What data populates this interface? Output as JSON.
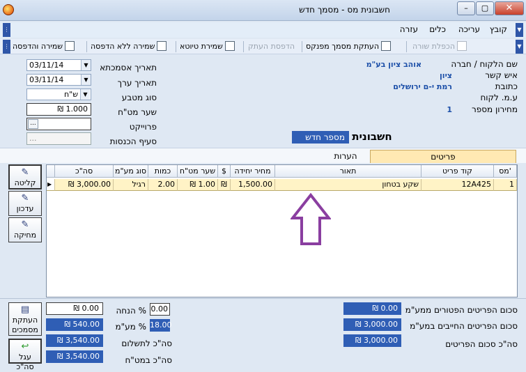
{
  "window": {
    "title": "חשבונית מס - מסמך חדש",
    "min_label": "–",
    "max_label": "▢",
    "close_label": "✕"
  },
  "menu": {
    "file": "קובץ",
    "edit": "עריכה",
    "tools": "כלים",
    "help": "עזרה"
  },
  "toolbar": {
    "duplicate_row": "הכפלת שורה",
    "copy_from_ledger": "העתקת מסמך מפנקס",
    "print_copy": "הדפסת העתק",
    "save_draft": "שמירת טיוטא",
    "save_no_print": "שמירה ללא הדפסה",
    "save_print": "שמירה והדפסה"
  },
  "customer": {
    "name_label": "שם הלקוח / חברה",
    "name_value": "אוהב ציון בע\"מ",
    "contact_label": "איש קשר",
    "contact_value": "ציון",
    "address_label": "כתובת",
    "address_value": "רמת י-ם ירושלים",
    "vat_id_label": "ע.מ. לקוח",
    "price_list_label": "מחירון מספר",
    "price_list_value": "1"
  },
  "document": {
    "ref_date_label": "תאריך אסמכתא",
    "ref_date_value": "03/11/14",
    "value_date_label": "תאריך ערך",
    "value_date_value": "03/11/14",
    "currency_label": "סוג מטבע",
    "currency_value": "ש\"ח",
    "rate_label": "שער מט\"ח",
    "rate_value": "₪ 1.000",
    "project_label": "פרוייקט",
    "project_value": "...",
    "income_label": "סעיף הכנסות",
    "income_value": "...",
    "title": "חשבונית מס",
    "number_value": "מספר חדש"
  },
  "tabs": {
    "items": "פריטים",
    "notes": "הערות"
  },
  "grid": {
    "headers": {
      "row": "מס'",
      "code": "קוד פריט",
      "desc": "תאור",
      "unit_price": "מחיר יחידה",
      "currency": "$",
      "rate": "שער מט\"ח",
      "qty": "כמות",
      "vat_type": "סוג מע\"מ",
      "total": "סה\"כ"
    },
    "rows": [
      {
        "row": "1",
        "code": "12A425",
        "desc": "שקע בטחון",
        "unit_price": "1,500.00",
        "currency": "₪",
        "rate": "₪ 1.00",
        "qty": "2.00",
        "vat_type": "רגיל",
        "total": "₪ 3,000.00"
      }
    ]
  },
  "side_buttons": {
    "receive": "קליטה",
    "update": "עדכון",
    "delete": "מחיקה",
    "copy_docs": "העתקת מסמכים",
    "round_total": "עגל סה\"כ"
  },
  "totals": {
    "exempt_label": "סכום הפריטים הפטורים ממע\"מ",
    "exempt_value": "₪ 0.00",
    "taxable_label": "סכום הפריטים החייבים במע\"מ",
    "taxable_value": "₪ 3,000.00",
    "items_total_label": "סה\"כ סכום הפריטים",
    "items_total_value": "₪ 3,000.00",
    "discount_label": "% הנחה",
    "discount_pct": "0.00",
    "discount_value": "₪ 0.00",
    "vat_label": "% מע\"מ",
    "vat_pct": "18.00",
    "vat_value": "₪ 540.00",
    "to_pay_label": "סה\"כ לתשלום",
    "to_pay_value": "₪ 3,540.00",
    "fx_total_label": "סה\"כ במט\"ח",
    "fx_total_value": "₪ 3,540.00"
  },
  "colors": {
    "accent_blue": "#2f5eb5",
    "row_highlight": "#fff3c6",
    "annotation_arrow": "#8a3ea0"
  }
}
